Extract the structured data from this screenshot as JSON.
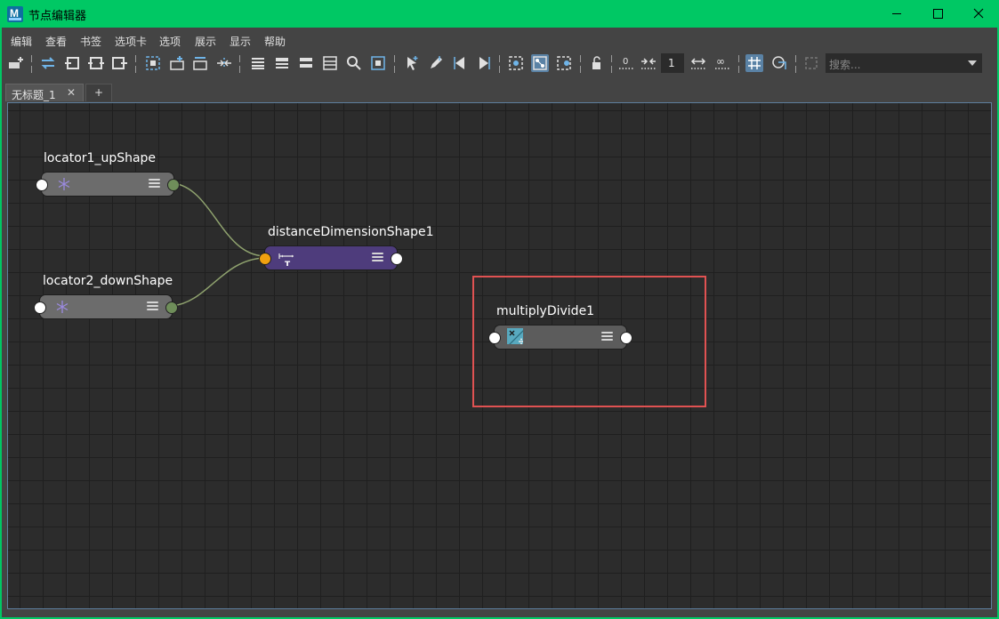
{
  "window": {
    "title": "节点编辑器",
    "app_icon_letter": "M",
    "controls": [
      "minimize-icon",
      "maximize-icon",
      "close-icon"
    ]
  },
  "menubar": {
    "items": [
      "编辑",
      "查看",
      "书签",
      "选项卡",
      "选项",
      "展示",
      "显示",
      "帮助"
    ]
  },
  "toolbar": {
    "node_count_value": "1",
    "search_placeholder": "搜索..."
  },
  "tabs": {
    "items": [
      {
        "label": "无标题_1",
        "close_glyph": "✕"
      }
    ],
    "add_label": "+"
  },
  "graph": {
    "nodes": [
      {
        "name": "locator1_upShape",
        "type": "locator-icon",
        "color": "#6c6c6c"
      },
      {
        "name": "locator2_downShape",
        "type": "locator-icon",
        "color": "#6c6c6c"
      },
      {
        "name": "distanceDimensionShape1",
        "type": "distance-dimension-icon",
        "color": "#4e3c7c"
      },
      {
        "name": "multiplyDivide1",
        "type": "multiply-divide-icon",
        "color": "#5c5c5c"
      }
    ],
    "connections": [
      {
        "from": "locator1_upShape",
        "to": "distanceDimensionShape1"
      },
      {
        "from": "locator2_downShape",
        "to": "distanceDimensionShape1"
      }
    ],
    "highlight_color": "#e05252"
  }
}
